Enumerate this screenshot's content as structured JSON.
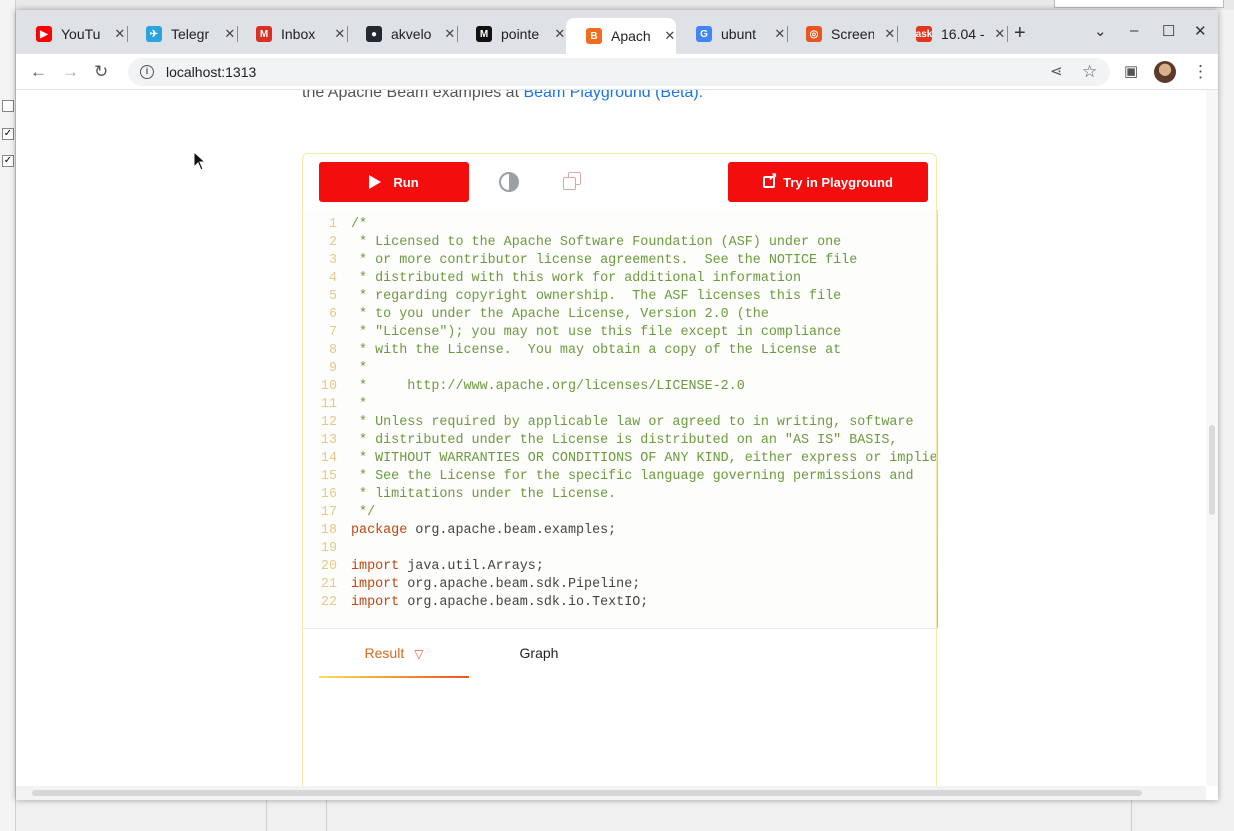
{
  "browser": {
    "tabs": [
      {
        "title": "YouTu",
        "icon": "youtube-icon",
        "color": "#ff0000",
        "glyph": "▶"
      },
      {
        "title": "Telegr",
        "icon": "telegram-icon",
        "color": "#2aa3df",
        "glyph": "✈"
      },
      {
        "title": "Inbox",
        "icon": "gmail-icon",
        "color": "#d93025",
        "glyph": "M"
      },
      {
        "title": "akvelo",
        "icon": "github-icon",
        "color": "#24292f",
        "glyph": "●"
      },
      {
        "title": "pointe",
        "icon": "medium-icon",
        "color": "#111111",
        "glyph": "M"
      },
      {
        "title": "Apach",
        "icon": "apache-beam-icon",
        "color": "#f26b1f",
        "glyph": "B"
      },
      {
        "title": "ubunt",
        "icon": "google-icon",
        "color": "#4285f4",
        "glyph": "G"
      },
      {
        "title": "Screen",
        "icon": "ubuntu-icon",
        "color": "#e95420",
        "glyph": "◎"
      },
      {
        "title": "16.04 -",
        "icon": "askubuntu-icon",
        "color": "#e0361d",
        "glyph": "ask"
      }
    ],
    "active_tab": 5,
    "url": "localhost:1313",
    "new_tab": "+",
    "controls": {
      "dropdown": "⌄",
      "minimize": "–",
      "maximize": "☐",
      "close": "✕"
    }
  },
  "page": {
    "intro_text": "the Apache Beam examples at ",
    "intro_link": "Beam Playground (Beta).",
    "run_label": "Run",
    "playground_label": "Try in Playground",
    "result_tab": "Result",
    "graph_tab": "Graph"
  },
  "code_lines": [
    {
      "n": "1",
      "parts": [
        [
          "c-comment",
          "/*"
        ]
      ]
    },
    {
      "n": "2",
      "parts": [
        [
          "c-comment",
          " * Licensed to the Apache Software Foundation (ASF) under one"
        ]
      ]
    },
    {
      "n": "3",
      "parts": [
        [
          "c-comment",
          " * or more contributor license agreements.  See the NOTICE file"
        ]
      ]
    },
    {
      "n": "4",
      "parts": [
        [
          "c-comment",
          " * distributed with this work for additional information"
        ]
      ]
    },
    {
      "n": "5",
      "parts": [
        [
          "c-comment",
          " * regarding copyright ownership.  The ASF licenses this file"
        ]
      ]
    },
    {
      "n": "6",
      "parts": [
        [
          "c-comment",
          " * to you under the Apache License, Version 2.0 (the"
        ]
      ]
    },
    {
      "n": "7",
      "parts": [
        [
          "c-comment",
          " * \"License\"); you may not use this file except in compliance"
        ]
      ]
    },
    {
      "n": "8",
      "parts": [
        [
          "c-comment",
          " * with the License.  You may obtain a copy of the License at"
        ]
      ]
    },
    {
      "n": "9",
      "parts": [
        [
          "c-comment",
          " *"
        ]
      ]
    },
    {
      "n": "10",
      "parts": [
        [
          "c-comment",
          " *     http://www.apache.org/licenses/LICENSE-2.0"
        ]
      ]
    },
    {
      "n": "11",
      "parts": [
        [
          "c-comment",
          " *"
        ]
      ]
    },
    {
      "n": "12",
      "parts": [
        [
          "c-comment",
          " * Unless required by applicable law or agreed to in writing, software"
        ]
      ]
    },
    {
      "n": "13",
      "parts": [
        [
          "c-comment",
          " * distributed under the License is distributed on an \"AS IS\" BASIS,"
        ]
      ]
    },
    {
      "n": "14",
      "parts": [
        [
          "c-comment",
          " * WITHOUT WARRANTIES OR CONDITIONS OF ANY KIND, either express or implied."
        ]
      ]
    },
    {
      "n": "15",
      "parts": [
        [
          "c-comment",
          " * See the License for the specific language governing permissions and"
        ]
      ]
    },
    {
      "n": "16",
      "parts": [
        [
          "c-comment",
          " * limitations under the License."
        ]
      ]
    },
    {
      "n": "17",
      "parts": [
        [
          "c-comment",
          " */"
        ]
      ]
    },
    {
      "n": "18",
      "parts": [
        [
          "c-kw",
          "package"
        ],
        [
          "c-plain",
          " org.apache.beam.examples;"
        ]
      ]
    },
    {
      "n": "19",
      "parts": [
        [
          "c-plain",
          ""
        ]
      ]
    },
    {
      "n": "20",
      "parts": [
        [
          "c-kw",
          "import"
        ],
        [
          "c-plain",
          " java.util.Arrays;"
        ]
      ]
    },
    {
      "n": "21",
      "parts": [
        [
          "c-kw",
          "import"
        ],
        [
          "c-plain",
          " org.apache.beam.sdk.Pipeline;"
        ]
      ]
    },
    {
      "n": "22",
      "parts": [
        [
          "c-kw",
          "import"
        ],
        [
          "c-plain",
          " org.apache.beam.sdk.io.TextIO;"
        ]
      ]
    }
  ]
}
